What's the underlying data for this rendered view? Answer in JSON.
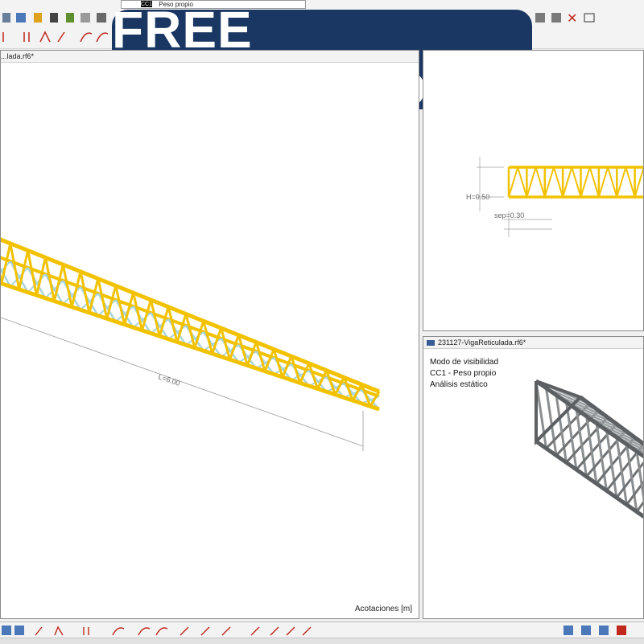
{
  "banner": {
    "text": "FREE DOWNLOAD"
  },
  "load_case": {
    "number": "CC1",
    "name": "Peso propio",
    "display": "CC1 - Peso propio"
  },
  "views": {
    "left": {
      "title": "...lada.rf6*",
      "units_label": "Acotaciones [m]",
      "length_dimension": "L=6.00"
    },
    "right_top": {
      "height_dimension": "H=0.50",
      "spacing_dimension": "sep=0.30"
    },
    "right_bottom": {
      "title": "231127-VigaReticulada.rf6*",
      "info_lines": [
        "Modo de visibilidad",
        "CC1 - Peso propio",
        "Análisis estático"
      ]
    }
  },
  "colors": {
    "chord": "#f2c200",
    "brace": "#a9d4dc",
    "render_member": "#8a8e90",
    "banner_bg": "#1a3764"
  },
  "icons": [
    "undo-icon",
    "save-icon",
    "section-icon",
    "member-icon",
    "support-icon",
    "load-icon",
    "mesh-icon",
    "results-icon",
    "view-icon",
    "delete-icon",
    "camera-icon"
  ]
}
